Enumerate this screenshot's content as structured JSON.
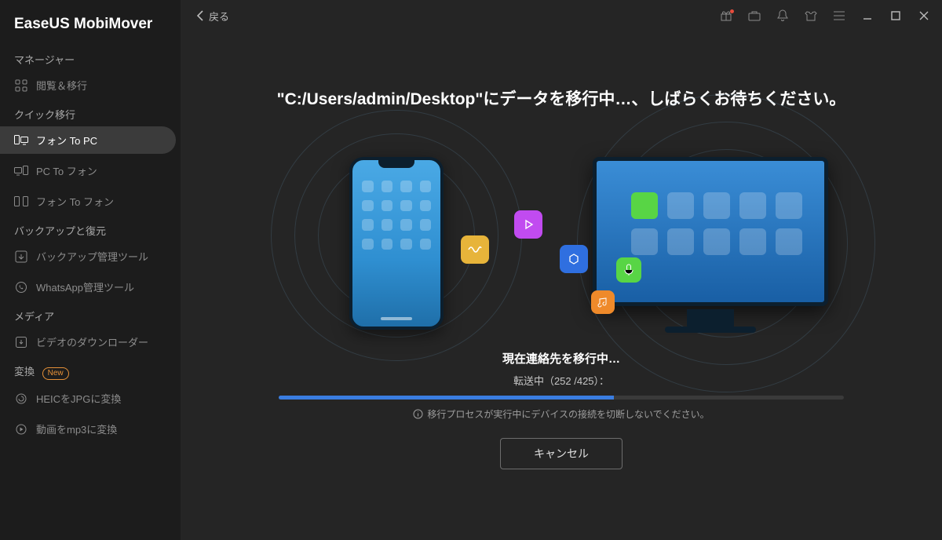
{
  "app_title": "EaseUS MobiMover",
  "titlebar": {
    "back": "戻る"
  },
  "sidebar": {
    "groups": [
      {
        "label": "マネージャー",
        "items": [
          {
            "icon": "grid-icon",
            "label": "閲覧＆移行"
          }
        ]
      },
      {
        "label": "クイック移行",
        "items": [
          {
            "icon": "phone-to-pc-icon",
            "label": "フォン To PC",
            "active": true
          },
          {
            "icon": "pc-to-phone-icon",
            "label": "PC To フォン"
          },
          {
            "icon": "phone-to-phone-icon",
            "label": "フォン To フォン"
          }
        ]
      },
      {
        "label": "バックアップと復元",
        "items": [
          {
            "icon": "backup-icon",
            "label": "バックアップ管理ツール"
          },
          {
            "icon": "whatsapp-icon",
            "label": "WhatsApp管理ツール"
          }
        ]
      },
      {
        "label": "メディア",
        "items": [
          {
            "icon": "download-icon",
            "label": "ビデオのダウンローダー"
          }
        ]
      },
      {
        "label": "変換",
        "badge": "New",
        "items": [
          {
            "icon": "heic-icon",
            "label": "HEICをJPGに変換"
          },
          {
            "icon": "video-icon",
            "label": "動画をmp3に変換"
          }
        ]
      }
    ]
  },
  "transfer": {
    "headline": "\"C:/Users/admin/Desktop\"にデータを移行中…、しばらくお待ちください。",
    "status": "現在連絡先を移行中…",
    "count_text": "転送中（252 /425）：",
    "progress_done": 252,
    "progress_total": 425,
    "progress_percent": 59.3,
    "warning": "移行プロセスが実行中にデバイスの接続を切断しないでください。",
    "cancel": "キャンセル"
  },
  "illustration": {
    "float_icons": [
      "wave-icon",
      "play-icon",
      "app-icon",
      "mic-icon",
      "music-icon"
    ],
    "monitor_cell_green": 0,
    "phone_icons_count": 16
  },
  "colors": {
    "accent": "#3a7de0",
    "sidebar_bg": "#1c1c1c",
    "main_bg": "#252525",
    "badge": "#e69138"
  }
}
